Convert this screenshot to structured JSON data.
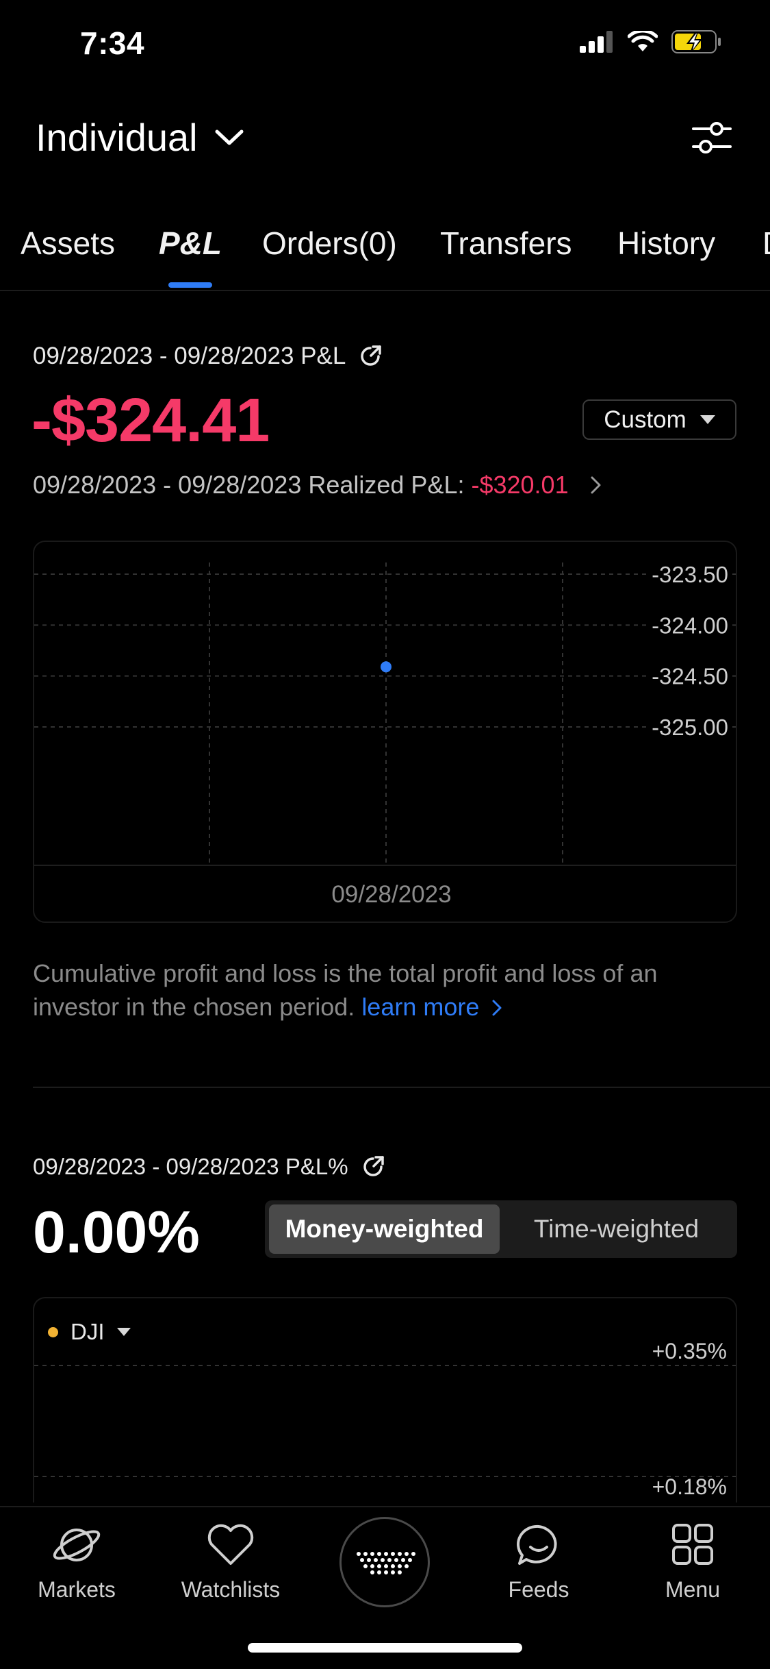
{
  "status_bar": {
    "time": "7:34"
  },
  "header": {
    "account": "Individual"
  },
  "tabs": [
    {
      "label": "Assets"
    },
    {
      "label": "P&L"
    },
    {
      "label": "Orders(0)"
    },
    {
      "label": "Transfers"
    },
    {
      "label": "History"
    },
    {
      "label": "D"
    }
  ],
  "pnl": {
    "range_label": "09/28/2023 - 09/28/2023 P&L",
    "value": "-$324.41",
    "period_button": "Custom",
    "realized_label": "09/28/2023 - 09/28/2023 Realized P&L:",
    "realized_value": "-$320.01",
    "explanation": "Cumulative profit and loss is the total profit and loss of an investor in the chosen period.",
    "learn_more": "learn more"
  },
  "pnl_percent": {
    "range_label": "09/28/2023 - 09/28/2023 P&L%",
    "value": "0.00%",
    "toggle": {
      "active": "Money-weighted",
      "inactive": "Time-weighted"
    },
    "benchmark": "DJI"
  },
  "chart_data": [
    {
      "type": "scatter",
      "title": "",
      "x": [
        "09/28/2023"
      ],
      "y": [
        -324.41
      ],
      "xlabel": "",
      "ylabel": "",
      "ylim": [
        -325.5,
        -323.4
      ],
      "y_ticks": [
        "-323.50",
        "-324.00",
        "-324.50",
        "-325.00"
      ],
      "x_ticks": [
        "09/28/2023"
      ],
      "grid": true
    },
    {
      "type": "line",
      "title": "",
      "legend": [
        "DJI"
      ],
      "y_ticks": [
        "+0.35%",
        "+0.18%"
      ],
      "grid": true
    }
  ],
  "bottom_nav": [
    {
      "label": "Markets",
      "icon": "planet-icon"
    },
    {
      "label": "Watchlists",
      "icon": "heart-icon"
    },
    {
      "label": "",
      "icon": "webull-logo-icon"
    },
    {
      "label": "Feeds",
      "icon": "chat-bubble-icon"
    },
    {
      "label": "Menu",
      "icon": "grid-icon"
    }
  ],
  "colors": {
    "negative": "#f53a68",
    "accent": "#2f7cf6",
    "benchmark": "#f2b233",
    "background": "#000000"
  }
}
